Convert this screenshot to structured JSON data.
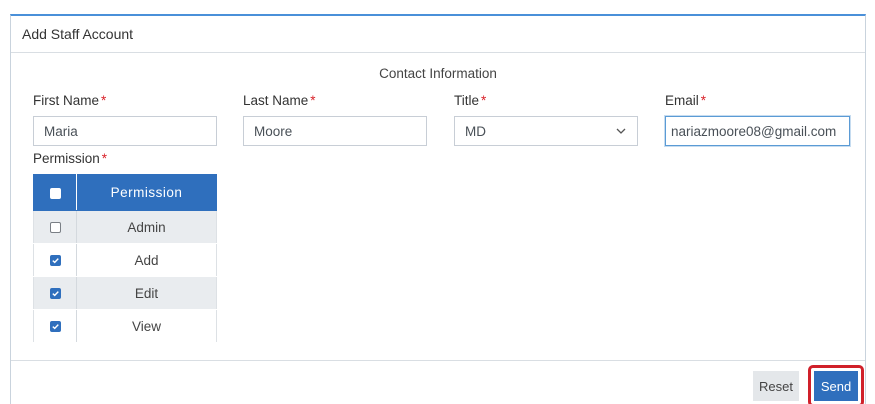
{
  "panel": {
    "title": "Add Staff Account"
  },
  "section": {
    "title": "Contact Information"
  },
  "fields": {
    "first_name": {
      "label": "First Name",
      "value": "Maria"
    },
    "last_name": {
      "label": "Last Name",
      "value": "Moore"
    },
    "title": {
      "label": "Title",
      "value": "MD"
    },
    "email": {
      "label": "Email",
      "value": "nariazmoore08@gmail.com"
    },
    "required_marker": "*"
  },
  "permission": {
    "label": "Permission",
    "column_header": "Permission",
    "rows": [
      {
        "name": "Admin",
        "checked": false
      },
      {
        "name": "Add",
        "checked": true
      },
      {
        "name": "Edit",
        "checked": true
      },
      {
        "name": "View",
        "checked": true
      }
    ]
  },
  "footer": {
    "reset_label": "Reset",
    "send_label": "Send"
  },
  "colors": {
    "accent": "#2f6fbd",
    "required": "#d9222a",
    "highlight": "#d0202a"
  }
}
